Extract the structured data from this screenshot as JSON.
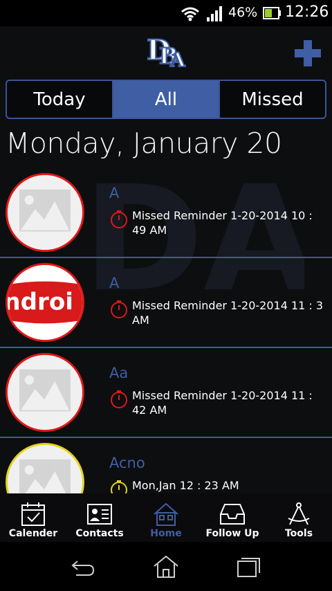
{
  "status_bar": {
    "battery_percent": "46%",
    "time": "12:26"
  },
  "header": {
    "logo_icon": "dba-logo-icon",
    "add_icon": "plus-icon"
  },
  "tabs": [
    {
      "label": "Today",
      "active": false
    },
    {
      "label": "All",
      "active": true
    },
    {
      "label": "Missed",
      "active": false
    }
  ],
  "date_heading": "Monday, January 20",
  "items": [
    {
      "name": "A",
      "reminder": "Missed Reminder 1-20-2014 10 : 49 AM",
      "avatar": "placeholder-image-icon",
      "status_color": "#e01818"
    },
    {
      "name": "A",
      "reminder": "Missed Reminder 1-20-2014 11 : 3 AM",
      "avatar": "android-logo-image",
      "avatar_text": "ndroi",
      "status_color": "#e01818"
    },
    {
      "name": "Aa",
      "reminder": "Missed Reminder 1-20-2014 11 : 42 AM",
      "avatar": "placeholder-image-icon",
      "status_color": "#e01818"
    },
    {
      "name": "Acno",
      "reminder": "Mon,Jan 12 : 23 AM",
      "avatar": "placeholder-image-icon",
      "status_color": "#e6d21a"
    }
  ],
  "bottom_nav": [
    {
      "label": "Calender",
      "icon": "calendar-icon",
      "active": false
    },
    {
      "label": "Contacts",
      "icon": "contact-card-icon",
      "active": false
    },
    {
      "label": "Home",
      "icon": "home-icon",
      "active": true
    },
    {
      "label": "Follow Up",
      "icon": "inbox-tray-icon",
      "active": false
    },
    {
      "label": "Tools",
      "icon": "compass-tools-icon",
      "active": false
    }
  ],
  "colors": {
    "accent": "#3f5ea4",
    "missed": "#e01818",
    "upcoming": "#e6d21a",
    "background": "#0d0e10"
  }
}
